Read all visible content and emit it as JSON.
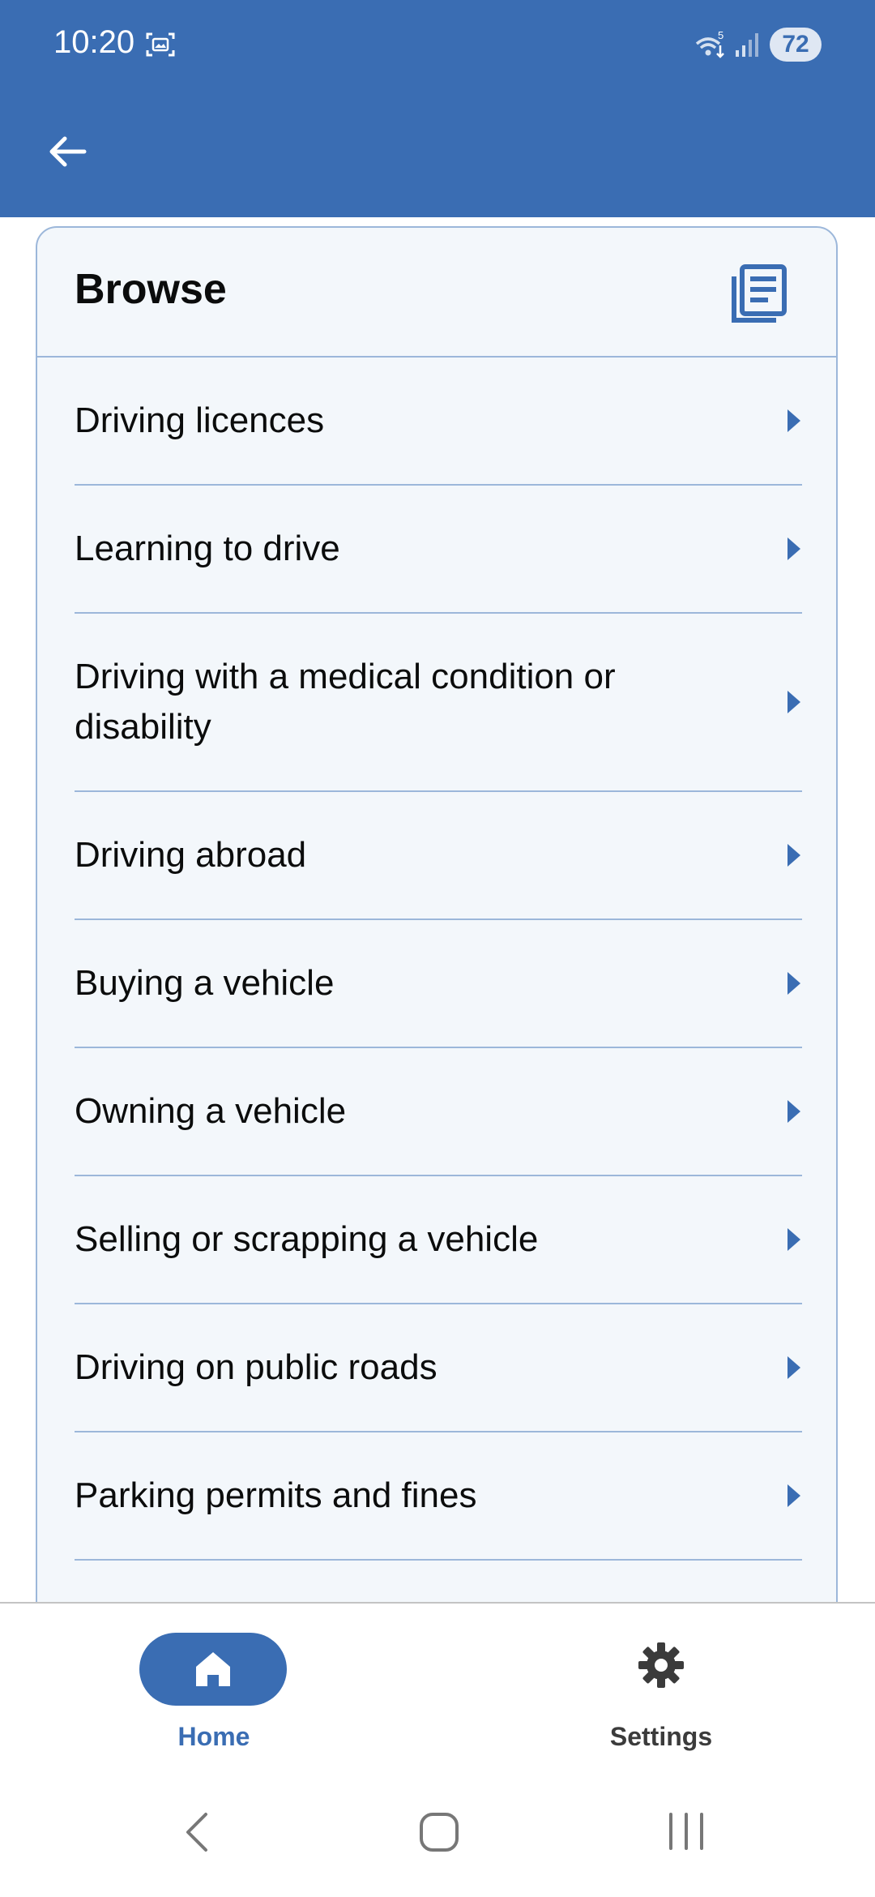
{
  "status_bar": {
    "time": "10:20",
    "battery": "72",
    "wifi_badge": "5"
  },
  "app_bar": {
    "back_icon": "arrow-left-icon"
  },
  "browse": {
    "title": "Browse",
    "header_icon": "document-list-icon",
    "items": [
      {
        "label": "Driving licences"
      },
      {
        "label": "Learning to drive"
      },
      {
        "label": "Driving with a medical condition or disability"
      },
      {
        "label": "Driving abroad"
      },
      {
        "label": "Buying a vehicle"
      },
      {
        "label": "Owning a vehicle"
      },
      {
        "label": "Selling or scrapping a vehicle"
      },
      {
        "label": "Driving on public roads"
      },
      {
        "label": "Parking permits and fines"
      }
    ]
  },
  "bottom_nav": {
    "home_label": "Home",
    "settings_label": "Settings",
    "active": "Home"
  },
  "colors": {
    "brand_blue": "#3a6db3",
    "card_background": "#f3f7fb",
    "divider": "#9cb7da",
    "text": "#0b0c0c"
  }
}
